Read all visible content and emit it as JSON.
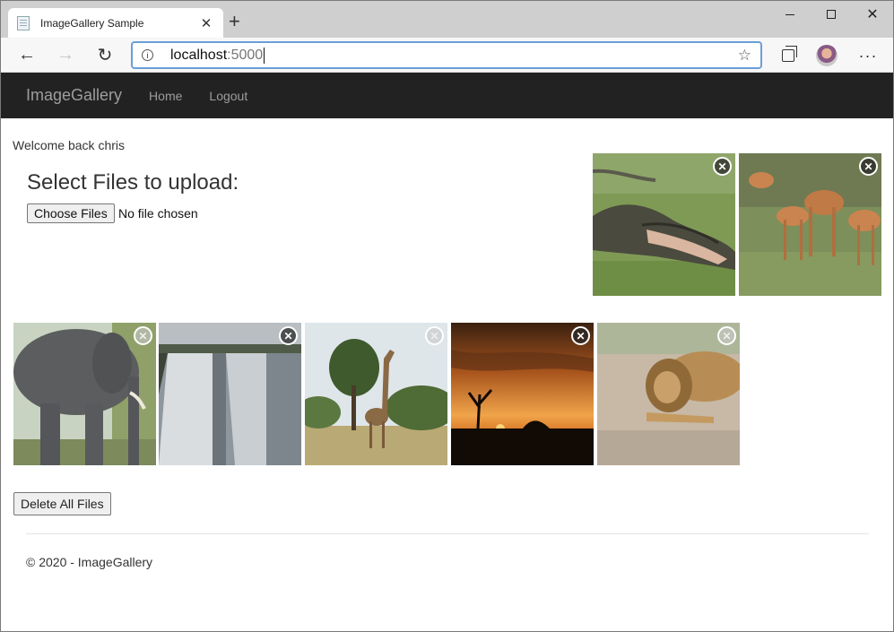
{
  "browser": {
    "tab_title": "ImageGallery Sample",
    "tab_close": "✕",
    "new_tab": "+",
    "address_host": "localhost",
    "address_port": ":5000",
    "star": "☆",
    "more": "···",
    "back": "←",
    "forward": "→",
    "reload": "↻",
    "info": "i",
    "close_window": "✕"
  },
  "nav": {
    "brand": "ImageGallery",
    "links": [
      "Home",
      "Logout"
    ]
  },
  "main": {
    "welcome": "Welcome back chris",
    "upload_title": "Select Files to upload:",
    "choose_files_label": "Choose Files",
    "no_file_text": "No file chosen",
    "delete_all_label": "Delete All Files",
    "remove_glyph": "✕"
  },
  "photos": [
    {
      "subject": "crocodile"
    },
    {
      "subject": "impalas"
    },
    {
      "subject": "elephant"
    },
    {
      "subject": "waterfall"
    },
    {
      "subject": "giraffe"
    },
    {
      "subject": "sunset"
    },
    {
      "subject": "lion"
    }
  ],
  "footer": {
    "text": "© 2020 - ImageGallery"
  }
}
